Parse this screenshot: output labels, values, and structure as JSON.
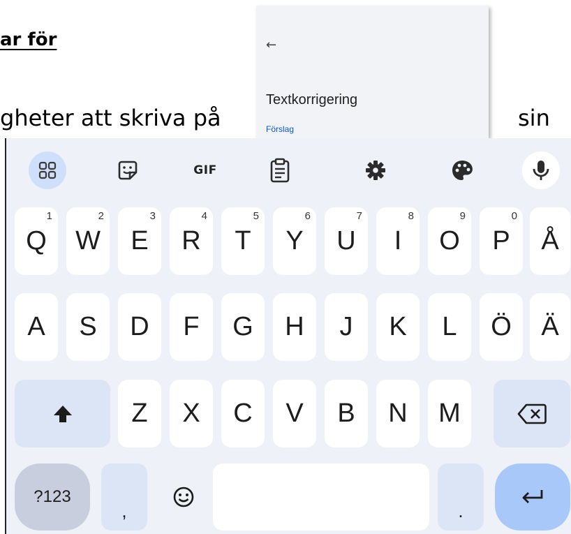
{
  "document": {
    "heading": "ar för",
    "line_left": "gheter att skriva på",
    "line_right": "sin"
  },
  "settings_panel": {
    "back_icon": "arrow-left-icon",
    "back_glyph": "←",
    "title": "Textkorrigering",
    "section": "Förslag"
  },
  "keyboard": {
    "toolbar": {
      "gif_label": "GIF",
      "icons": [
        "apps-grid-icon",
        "sticker-icon",
        "gif-icon",
        "clipboard-icon",
        "settings-gear-icon",
        "palette-icon",
        "microphone-icon"
      ]
    },
    "row1": [
      "Q",
      "W",
      "E",
      "R",
      "T",
      "Y",
      "U",
      "I",
      "O",
      "P",
      "Å"
    ],
    "row1_hints": [
      "1",
      "2",
      "3",
      "4",
      "5",
      "6",
      "7",
      "8",
      "9",
      "0",
      ""
    ],
    "row2": [
      "A",
      "S",
      "D",
      "F",
      "G",
      "H",
      "J",
      "K",
      "L",
      "Ö",
      "Ä"
    ],
    "row3": [
      "Z",
      "X",
      "C",
      "V",
      "B",
      "N",
      "M"
    ],
    "bottom": {
      "symbols_label": "?123",
      "comma": ",",
      "period": "."
    },
    "colors": {
      "accent": "#a9c8fa",
      "toolbar_active": "#cfdffb",
      "special_key": "#dbe5f6",
      "background": "#eef1f8"
    }
  }
}
